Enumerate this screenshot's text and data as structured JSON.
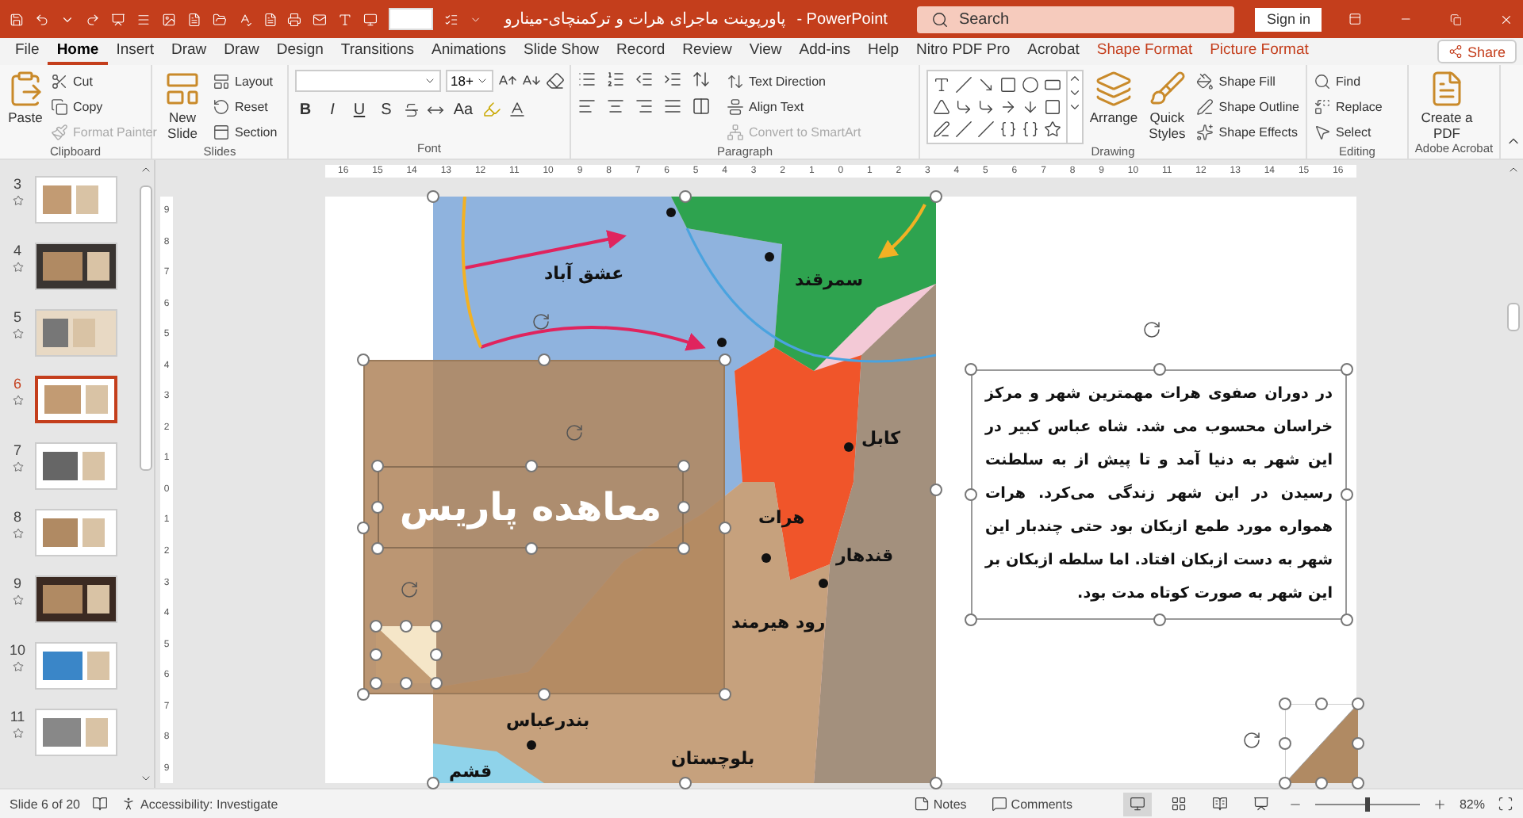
{
  "title_bar": {
    "document_title": "پاورپوینت ماجرای هرات و ترکمنچای-مینارو",
    "app_name": "- PowerPoint",
    "search": {
      "placeholder": "Search"
    },
    "sign_in": "Sign in"
  },
  "tabs": [
    {
      "label": "File",
      "selected": false,
      "kind": "normal"
    },
    {
      "label": "Home",
      "selected": true,
      "kind": "normal"
    },
    {
      "label": "Insert",
      "selected": false,
      "kind": "normal"
    },
    {
      "label": "Draw",
      "selected": false,
      "kind": "normal"
    },
    {
      "label": "Draw",
      "selected": false,
      "kind": "normal"
    },
    {
      "label": "Design",
      "selected": false,
      "kind": "normal"
    },
    {
      "label": "Transitions",
      "selected": false,
      "kind": "normal"
    },
    {
      "label": "Animations",
      "selected": false,
      "kind": "normal"
    },
    {
      "label": "Slide Show",
      "selected": false,
      "kind": "normal"
    },
    {
      "label": "Record",
      "selected": false,
      "kind": "normal"
    },
    {
      "label": "Review",
      "selected": false,
      "kind": "normal"
    },
    {
      "label": "View",
      "selected": false,
      "kind": "normal"
    },
    {
      "label": "Add-ins",
      "selected": false,
      "kind": "normal"
    },
    {
      "label": "Help",
      "selected": false,
      "kind": "normal"
    },
    {
      "label": "Nitro PDF Pro",
      "selected": false,
      "kind": "normal"
    },
    {
      "label": "Acrobat",
      "selected": false,
      "kind": "normal"
    },
    {
      "label": "Shape Format",
      "selected": false,
      "kind": "contextual"
    },
    {
      "label": "Picture Format",
      "selected": false,
      "kind": "contextual"
    }
  ],
  "share": "Share",
  "ribbon": {
    "groups": [
      {
        "kind": "clipboard",
        "label": "Clipboard",
        "buttons": [
          {
            "label": "Paste",
            "disabled": false
          },
          {
            "label": "Cut",
            "disabled": false
          },
          {
            "label": "Copy",
            "disabled": false
          },
          {
            "label": "Format Painter",
            "disabled": true
          }
        ]
      },
      {
        "kind": "slides",
        "label": "Slides",
        "buttons": [
          {
            "label": "New Slide",
            "disabled": false
          },
          {
            "label": "Layout",
            "disabled": false
          },
          {
            "label": "Reset",
            "disabled": false
          },
          {
            "label": "Section",
            "disabled": false
          }
        ]
      },
      {
        "kind": "font",
        "label": "Font",
        "size": "18+",
        "format_buttons": [
          "B",
          "I",
          "U",
          "S"
        ],
        "case_button": "Aa"
      },
      {
        "kind": "paragraph",
        "label": "Paragraph",
        "buttons": [
          {
            "label": "Text Direction",
            "disabled": false
          },
          {
            "label": "Align Text",
            "disabled": false
          },
          {
            "label": "Convert to SmartArt",
            "disabled": true
          }
        ]
      },
      {
        "kind": "drawing",
        "label": "Drawing",
        "buttons": [
          {
            "label": "Arrange",
            "disabled": false
          },
          {
            "label": "Quick Styles",
            "disabled": false
          },
          {
            "label": "Shape Fill",
            "disabled": false
          },
          {
            "label": "Shape Outline",
            "disabled": false
          },
          {
            "label": "Shape Effects",
            "disabled": false
          }
        ]
      },
      {
        "kind": "editing",
        "label": "Editing",
        "buttons": [
          {
            "label": "Find",
            "disabled": false
          },
          {
            "label": "Replace",
            "disabled": false
          },
          {
            "label": "Select",
            "disabled": false
          }
        ]
      },
      {
        "kind": "acrobat",
        "label": "Adobe Acrobat",
        "buttons": [
          {
            "label": "Create a PDF",
            "disabled": false
          }
        ]
      }
    ]
  },
  "slides_panel": [
    {
      "number": "3",
      "selected": false
    },
    {
      "number": "4",
      "selected": false
    },
    {
      "number": "5",
      "selected": false
    },
    {
      "number": "6",
      "selected": true
    },
    {
      "number": "7",
      "selected": false
    },
    {
      "number": "8",
      "selected": false
    },
    {
      "number": "9",
      "selected": false
    },
    {
      "number": "10",
      "selected": false
    },
    {
      "number": "11",
      "selected": false
    }
  ],
  "rulers": {
    "horizontal": [
      "16",
      "15",
      "14",
      "13",
      "12",
      "11",
      "10",
      "9",
      "8",
      "7",
      "6",
      "5",
      "4",
      "3",
      "2",
      "1",
      "0",
      "1",
      "2",
      "3",
      "4",
      "5",
      "6",
      "7",
      "8",
      "9",
      "10",
      "11",
      "12",
      "13",
      "14",
      "15",
      "16"
    ],
    "vertical": [
      "9",
      "8",
      "7",
      "6",
      "5",
      "4",
      "3",
      "2",
      "1",
      "0",
      "1",
      "2",
      "3",
      "4",
      "5",
      "6",
      "7",
      "8",
      "9"
    ]
  },
  "slide": {
    "title": "معاهده پاریس",
    "map_labels": [
      "عشق آباد",
      "سمرقند",
      "کابل",
      "هرات",
      "قندهار",
      "رود هیرمند",
      "بندرعباس",
      "بلوچستان",
      "قشم"
    ],
    "body": "در دوران صفوی هرات مهمترین شهر و مرکز خراسان محسوب می شد. شاه عباس کبیر در این شهر به دنیا آمد و تا پیش از به سلطنت رسیدن در این شهر زندگی می‌کرد. هرات همواره مورد طمع ازبکان بود حتی چندبار این شهر به دست ازبکان افتاد. اما سلطه ازبکان بر این شهر به صورت کوتاه مدت بود."
  },
  "status_bar": {
    "slide_info": "Slide 6 of 20",
    "accessibility": "Accessibility: Investigate",
    "notes": "Notes",
    "comments": "Comments",
    "views": [
      {
        "selected": true
      },
      {
        "selected": false
      },
      {
        "selected": false
      },
      {
        "selected": false
      }
    ],
    "zoom": {
      "level": 0.5,
      "reading": "82%"
    }
  }
}
